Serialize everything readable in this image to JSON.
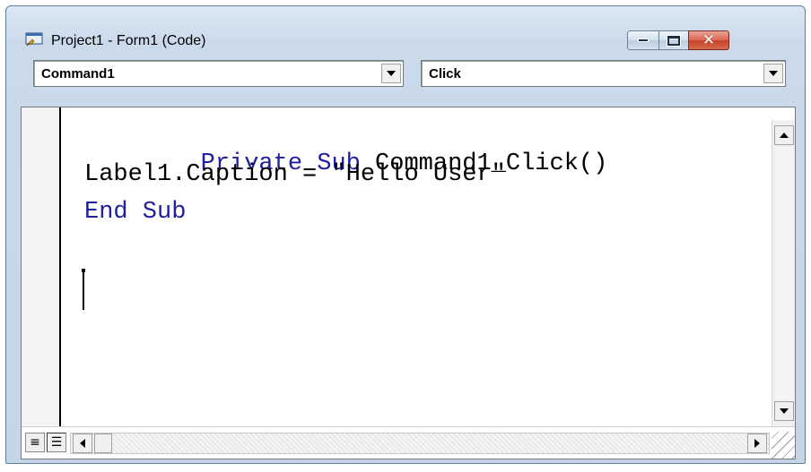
{
  "window": {
    "title": "Project1 - Form1 (Code)",
    "icon": "vb-form-icon",
    "controls": {
      "minimize": "minimize-icon",
      "maximize": "maximize-icon",
      "close": "close-icon",
      "close_glyph": "✕"
    }
  },
  "object_combo": {
    "value": "Command1"
  },
  "procedure_combo": {
    "value": "Click"
  },
  "code": {
    "line1_keyword": "Private Sub",
    "line1_rest": " Command1_Click()",
    "line2": "Label1.Caption = \"Hello User\"",
    "line3": "End Sub"
  },
  "view_buttons": {
    "procedure_view_glyph": "≡",
    "full_module_view_glyph": "☰"
  },
  "colors": {
    "keyword": "#1f1f9f",
    "text": "#000000",
    "close_button": "#c74226"
  }
}
